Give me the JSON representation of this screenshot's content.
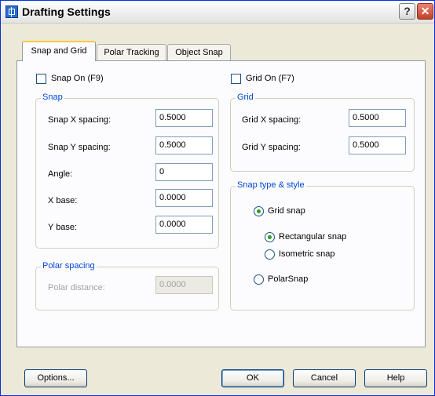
{
  "window": {
    "title": "Drafting Settings",
    "help_glyph": "?",
    "close_glyph": "✕"
  },
  "tabs": [
    {
      "label": "Snap and Grid",
      "active": true
    },
    {
      "label": "Polar Tracking",
      "active": false
    },
    {
      "label": "Object Snap",
      "active": false
    }
  ],
  "snap_on": {
    "label": "Snap On (F9)",
    "checked": false
  },
  "grid_on": {
    "label": "Grid On (F7)",
    "checked": false
  },
  "snap_group": {
    "title": "Snap",
    "fields": [
      {
        "label": "Snap X spacing:",
        "value": "0.5000"
      },
      {
        "label": "Snap Y spacing:",
        "value": "0.5000"
      },
      {
        "label": "Angle:",
        "value": "0"
      },
      {
        "label": "X base:",
        "value": "0.0000"
      },
      {
        "label": "Y base:",
        "value": "0.0000"
      }
    ]
  },
  "polar_spacing": {
    "title": "Polar spacing",
    "label": "Polar distance:",
    "value": "0.0000"
  },
  "grid_group": {
    "title": "Grid",
    "fields": [
      {
        "label": "Grid X spacing:",
        "value": "0.5000"
      },
      {
        "label": "Grid Y spacing:",
        "value": "0.5000"
      }
    ]
  },
  "snap_type": {
    "title": "Snap type & style",
    "grid_snap": {
      "label": "Grid snap",
      "checked": true
    },
    "rectangular_snap": {
      "label": "Rectangular snap",
      "checked": true
    },
    "isometric_snap": {
      "label": "Isometric snap",
      "checked": false
    },
    "polar_snap": {
      "label": "PolarSnap",
      "checked": false
    }
  },
  "buttons": {
    "options": "Options...",
    "ok": "OK",
    "cancel": "Cancel",
    "help": "Help"
  }
}
